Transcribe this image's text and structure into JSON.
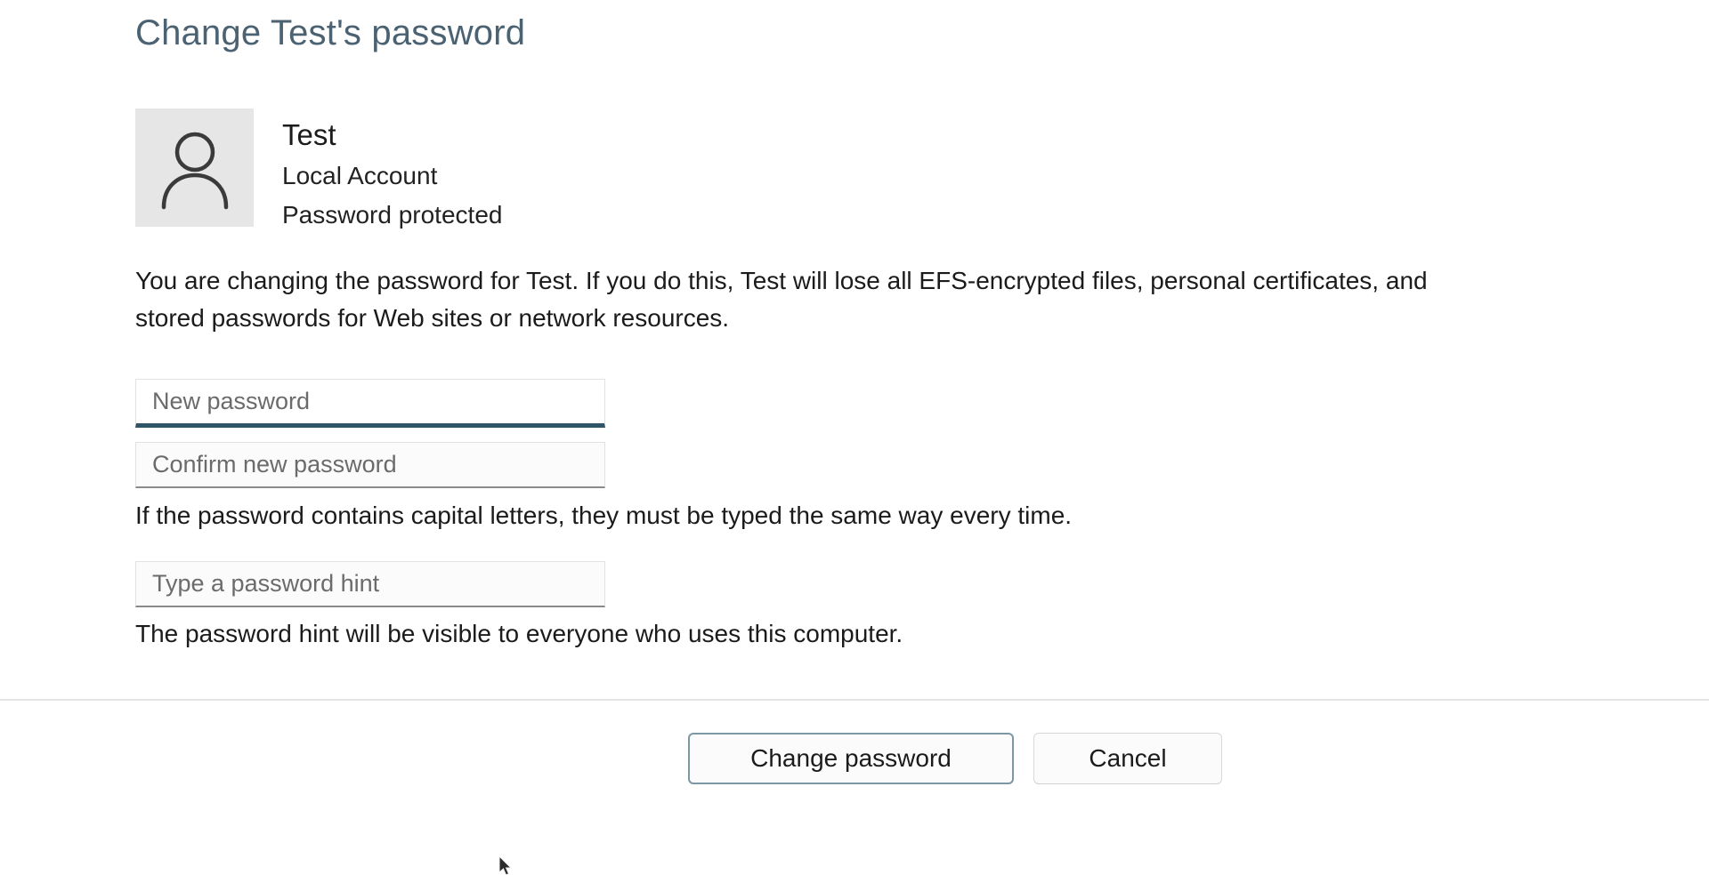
{
  "window": {
    "title": "Change Test's password"
  },
  "account": {
    "avatar_icon": "person-icon",
    "name": "Test",
    "type": "Local Account",
    "status": "Password protected"
  },
  "description": "You are changing the password for Test.  If you do this, Test will lose all EFS-encrypted files, personal certificates, and stored passwords for Web sites or network resources.",
  "form": {
    "new_password": {
      "placeholder": "New password",
      "value": "",
      "focused": true
    },
    "confirm_password": {
      "placeholder": "Confirm new password",
      "value": "",
      "focused": false
    },
    "capital_letters_note": "If the password contains capital letters, they must be typed the same way every time.",
    "password_hint": {
      "placeholder": "Type a password hint",
      "value": "",
      "focused": false
    },
    "hint_visibility_note": "The password hint will be visible to everyone who uses this computer."
  },
  "footer": {
    "primary_label": "Change password",
    "secondary_label": "Cancel"
  },
  "colors": {
    "title": "#4b6272",
    "focus_underline": "#2e5568",
    "default_button_border": "#7b98a4",
    "avatar_background": "#e6e6e6",
    "separator": "#e4e4e4"
  }
}
